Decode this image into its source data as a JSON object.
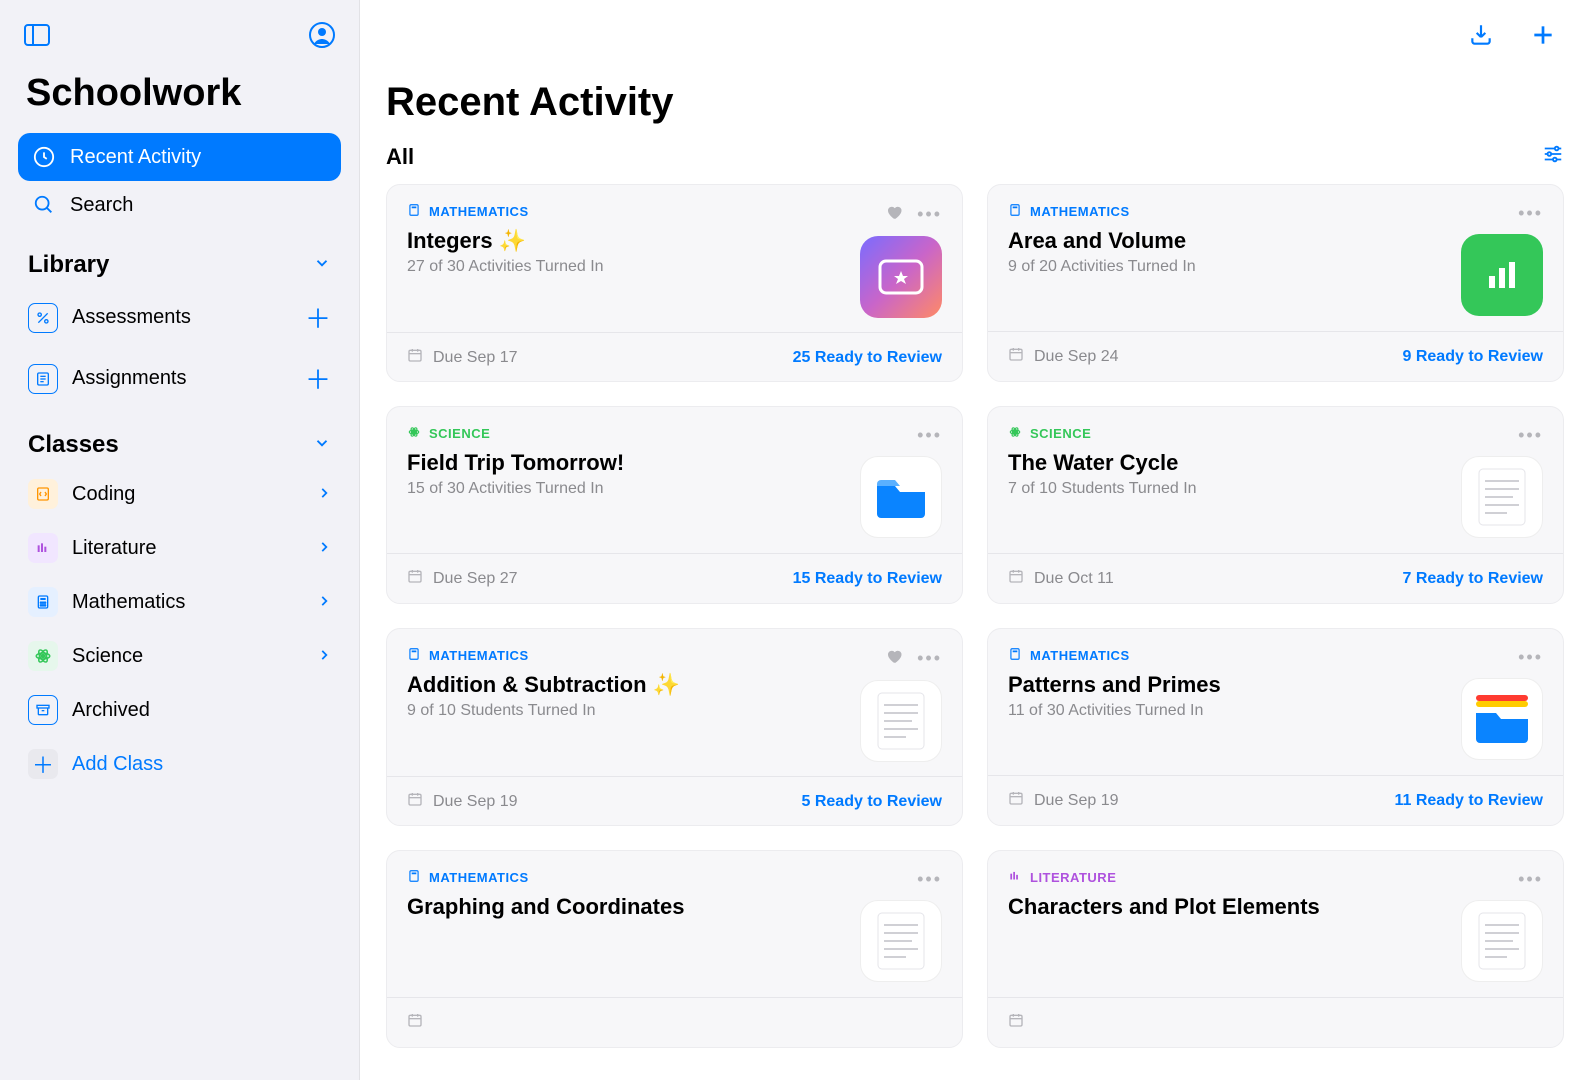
{
  "app": {
    "title": "Schoolwork"
  },
  "sidebar": {
    "nav": {
      "recent": "Recent Activity",
      "search": "Search"
    },
    "library": {
      "header": "Library",
      "assessments": "Assessments",
      "assignments": "Assignments"
    },
    "classes": {
      "header": "Classes",
      "items": [
        {
          "label": "Coding",
          "color": "orange"
        },
        {
          "label": "Literature",
          "color": "purple"
        },
        {
          "label": "Mathematics",
          "color": "blue"
        },
        {
          "label": "Science",
          "color": "green"
        }
      ],
      "archived": "Archived",
      "add": "Add Class"
    }
  },
  "main": {
    "title": "Recent Activity",
    "filter_label": "All",
    "cards": [
      {
        "subject": "MATHEMATICS",
        "subject_class": "math",
        "title": "Integers ✨",
        "sub": "27 of 30 Activities Turned In",
        "due": "Due Sep 17",
        "review": "25 Ready to Review",
        "favorite": true,
        "thumb": "gradient1"
      },
      {
        "subject": "MATHEMATICS",
        "subject_class": "math",
        "title": "Area and Volume",
        "sub": "9 of 20 Activities Turned In",
        "due": "Due Sep 24",
        "review": "9 Ready to Review",
        "favorite": false,
        "thumb": "green-chart"
      },
      {
        "subject": "SCIENCE",
        "subject_class": "science",
        "title": "Field Trip Tomorrow!",
        "sub": "15 of 30 Activities Turned In",
        "due": "Due Sep 27",
        "review": "15 Ready to Review",
        "favorite": false,
        "thumb": "folder-blue"
      },
      {
        "subject": "SCIENCE",
        "subject_class": "science",
        "title": "The Water Cycle",
        "sub": "7 of 10 Students Turned In",
        "due": "Due Oct 11",
        "review": "7 Ready to Review",
        "favorite": false,
        "thumb": "doc"
      },
      {
        "subject": "MATHEMATICS",
        "subject_class": "math",
        "title": "Addition & Subtraction ✨",
        "sub": "9 of 10 Students Turned In",
        "due": "Due Sep 19",
        "review": "5 Ready to Review",
        "favorite": true,
        "thumb": "doc"
      },
      {
        "subject": "MATHEMATICS",
        "subject_class": "math",
        "title": "Patterns and Primes",
        "sub": "11 of 30 Activities Turned In",
        "due": "Due Sep 19",
        "review": "11 Ready to Review",
        "favorite": false,
        "thumb": "folder-multi"
      },
      {
        "subject": "MATHEMATICS",
        "subject_class": "math",
        "title": "Graphing and Coordinates",
        "sub": "",
        "due": "",
        "review": "",
        "favorite": false,
        "thumb": "doc"
      },
      {
        "subject": "LITERATURE",
        "subject_class": "literature",
        "title": "Characters and Plot Elements",
        "sub": "",
        "due": "",
        "review": "",
        "favorite": false,
        "thumb": "doc"
      }
    ]
  }
}
